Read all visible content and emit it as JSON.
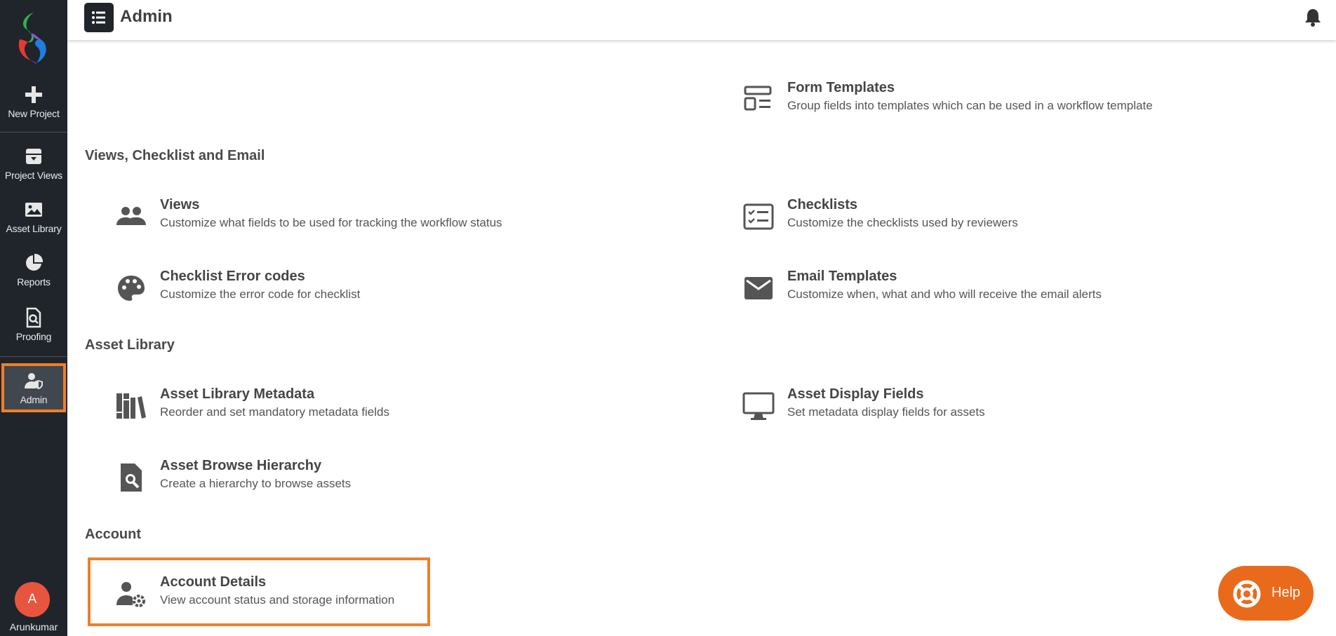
{
  "app": {
    "page_title": "Admin"
  },
  "sidebar": {
    "items": [
      {
        "label": "New Project",
        "icon": "plus-icon"
      },
      {
        "label": "Project Views",
        "icon": "archive-icon"
      },
      {
        "label": "Asset Library",
        "icon": "image-icon"
      },
      {
        "label": "Reports",
        "icon": "pie-chart-icon"
      },
      {
        "label": "Proofing",
        "icon": "file-search-icon"
      },
      {
        "label": "Admin",
        "icon": "user-shield-icon",
        "active": true
      }
    ],
    "user": {
      "initial": "A",
      "name": "Arunkumar"
    }
  },
  "sections": {
    "views": "Views, Checklist and Email",
    "asset_library": "Asset Library",
    "account": "Account"
  },
  "cards": {
    "form_templates": {
      "title": "Form Templates",
      "desc": "Group fields into templates which can be used in a workflow template",
      "icon": "form-template-icon"
    },
    "views": {
      "title": "Views",
      "desc": "Customize what fields to be used for tracking the workflow status",
      "icon": "people-icon"
    },
    "checklists": {
      "title": "Checklists",
      "desc": "Customize the checklists used by reviewers",
      "icon": "checklist-icon"
    },
    "error_codes": {
      "title": "Checklist Error codes",
      "desc": "Customize the error code for checklist",
      "icon": "palette-icon"
    },
    "email_templates": {
      "title": "Email Templates",
      "desc": "Customize when, what and who will receive the email alerts",
      "icon": "mail-icon"
    },
    "asset_metadata": {
      "title": "Asset Library Metadata",
      "desc": "Reorder and set mandatory metadata fields",
      "icon": "books-icon"
    },
    "asset_display": {
      "title": "Asset Display Fields",
      "desc": "Set metadata display fields for assets",
      "icon": "monitor-icon"
    },
    "asset_browse": {
      "title": "Asset Browse Hierarchy",
      "desc": "Create a hierarchy to browse assets",
      "icon": "file-search-icon"
    },
    "account_details": {
      "title": "Account Details",
      "desc": "View account status and storage information",
      "icon": "user-gear-icon"
    }
  },
  "help": {
    "label": "Help",
    "icon": "lifebuoy-icon"
  },
  "colors": {
    "sidebar": "#1f252b",
    "accent": "#f07f2a",
    "help": "#ea6a1c",
    "avatar": "#e8553f"
  }
}
